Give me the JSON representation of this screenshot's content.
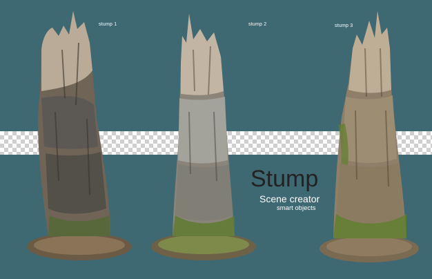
{
  "labels": {
    "stump1": "stump 1",
    "stump2": "stump 2",
    "stump3": "stump 3"
  },
  "title": "Stump",
  "subtitle": "Scene creator",
  "tagline": "smart objects",
  "colors": {
    "background": "#3e6872",
    "checker_light": "#ffffff",
    "checker_dark": "#cfcfcf",
    "title": "#222222",
    "text": "#ffffff"
  }
}
